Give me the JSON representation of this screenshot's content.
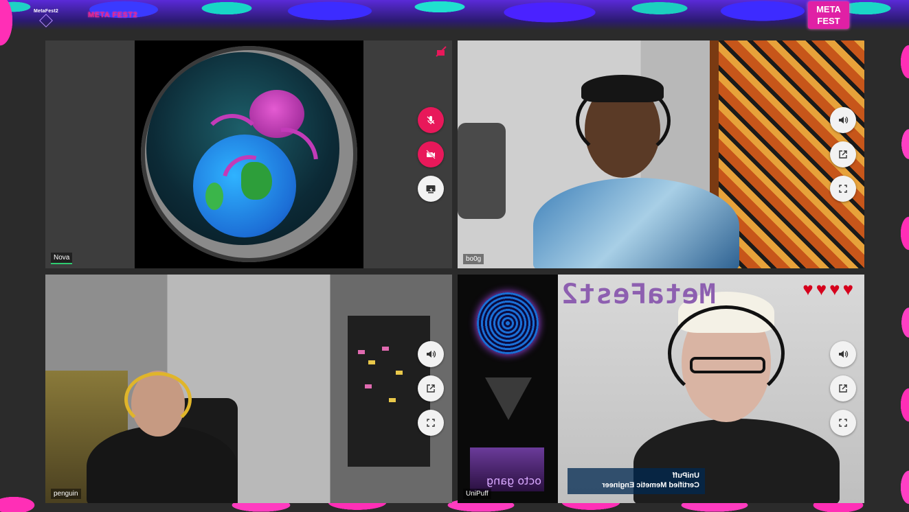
{
  "header": {
    "left_logo_text": "MetaFest2",
    "center_text": "META FEST2",
    "right_logo_line1": "META",
    "right_logo_line2": "FEST"
  },
  "tiles": [
    {
      "name": "Nova",
      "controls": [
        "mic-off-icon",
        "camera-off-icon",
        "share-screen-icon"
      ],
      "status_icon": "video-off-indicator-icon"
    },
    {
      "name": "bo0g",
      "controls": [
        "volume-icon",
        "pop-out-icon",
        "fullscreen-icon"
      ]
    },
    {
      "name": "penguin",
      "controls": [
        "volume-icon",
        "pop-out-icon",
        "fullscreen-icon"
      ]
    },
    {
      "name": "UniPuff",
      "controls": [
        "volume-icon",
        "pop-out-icon",
        "fullscreen-icon"
      ],
      "overlay_title": "MetaFest2",
      "overlay_gang": "octo gang",
      "lower_third_name": "UniPuff",
      "lower_third_role": "Certified Memetic Engineer",
      "hearts": "♥♥♥♥"
    }
  ],
  "colors": {
    "accent_red": "#e8185a",
    "frame_pink": "#ff2fb6",
    "frame_teal": "#1fd1c5",
    "active_speaker": "#2ecc71"
  }
}
